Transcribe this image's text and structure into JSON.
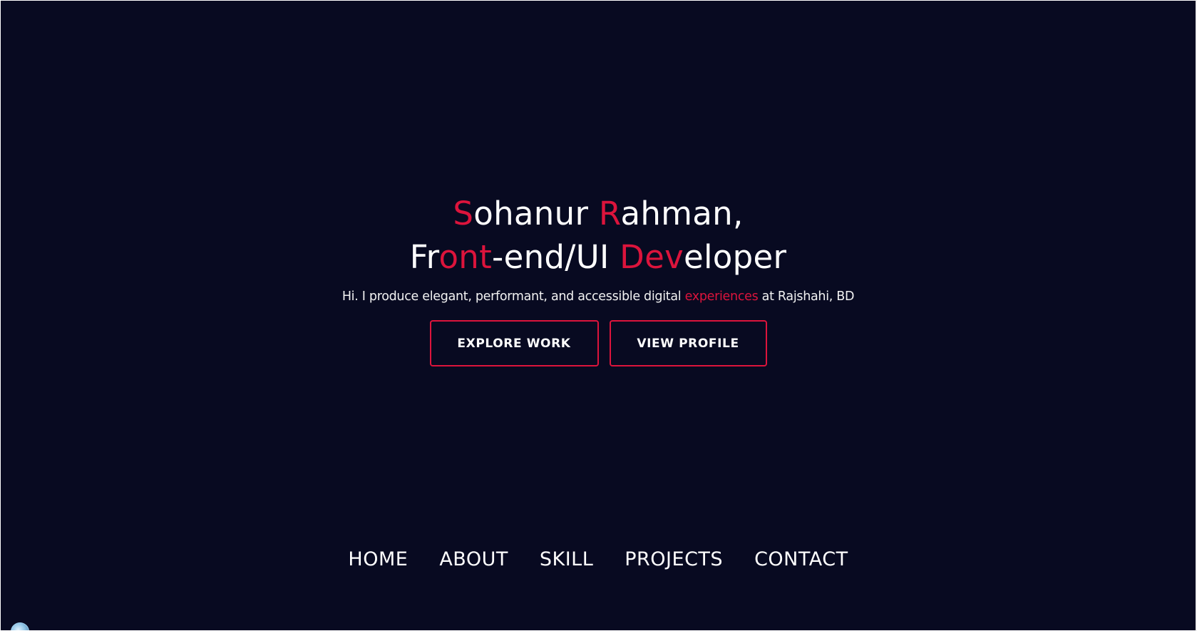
{
  "hero": {
    "name_line": [
      {
        "text": "S",
        "accent": true
      },
      {
        "text": "ohanur ",
        "accent": false
      },
      {
        "text": "R",
        "accent": true
      },
      {
        "text": "ahman,",
        "accent": false
      }
    ],
    "role_line": [
      {
        "text": "Fr",
        "accent": false
      },
      {
        "text": "ont",
        "accent": true
      },
      {
        "text": "-end/UI ",
        "accent": false
      },
      {
        "text": "Dev",
        "accent": true
      },
      {
        "text": "eloper",
        "accent": false
      }
    ],
    "subtitle_before": "Hi. I produce elegant, performant, and accessible digital ",
    "subtitle_accent": "experiences",
    "subtitle_after": " at Rajshahi, BD"
  },
  "buttons": {
    "explore": "EXPLORE WORK",
    "profile": "VIEW PROFILE"
  },
  "nav": {
    "items": [
      "HOME",
      "ABOUT",
      "SKILL",
      "PROJECTS",
      "CONTACT"
    ]
  },
  "colors": {
    "background": "#080a21",
    "accent": "#dc143c",
    "text": "#ffffff"
  }
}
